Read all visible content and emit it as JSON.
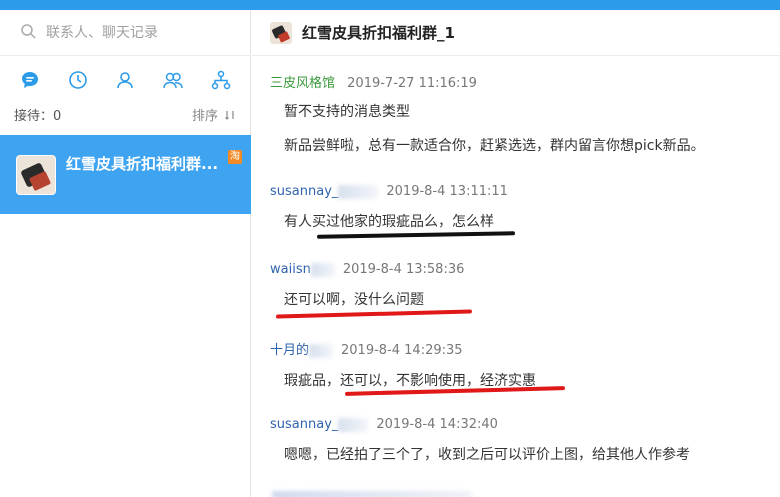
{
  "search": {
    "placeholder": "联系人、聊天记录"
  },
  "tabs": [
    {
      "icon": "chat-bubble-icon",
      "active": true
    },
    {
      "icon": "clock-icon",
      "active": false
    },
    {
      "icon": "person-icon",
      "active": false
    },
    {
      "icon": "group-icon",
      "active": false
    },
    {
      "icon": "org-tree-icon",
      "active": false
    }
  ],
  "reception": {
    "label": "接待：0"
  },
  "sort": {
    "label": "排序"
  },
  "conversation": {
    "title": "红雪皮具折扣福利群...",
    "badge": "淘"
  },
  "chat": {
    "title": "红雪皮具折扣福利群_1"
  },
  "messages": [
    {
      "sender": "三皮风格馆",
      "time": "2019-7-27 11:16:19",
      "lines": [
        "暂不支持的消息类型",
        "新品尝鲜啦，总有一款适合你，赶紧选选，群内留言你想pick新品。"
      ]
    },
    {
      "sender": "susannay_",
      "time": "2019-8-4 13:11:11",
      "lines": [
        "有人买过他家的瑕疵品么，怎么样"
      ]
    },
    {
      "sender": "waiisn",
      "time": "2019-8-4 13:58:36",
      "lines": [
        "还可以啊，没什么问题"
      ]
    },
    {
      "sender": "十月的",
      "time": "2019-8-4 14:29:35",
      "lines": [
        "瑕疵品，还可以，不影响使用，经济实惠"
      ]
    },
    {
      "sender": "susannay_",
      "time": "2019-8-4 14:32:40",
      "lines": [
        "嗯嗯，已经拍了三个了，收到之后可以评价上图，给其他人作参考"
      ]
    }
  ],
  "colors": {
    "accent": "#3ea3f0",
    "underline_red": "#e01818",
    "underline_black": "#111111"
  }
}
